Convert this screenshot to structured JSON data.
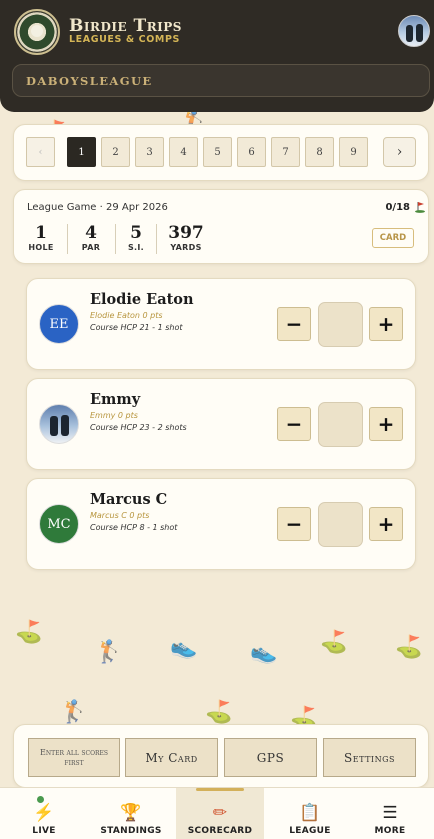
{
  "brand": {
    "title": "Birdie Trips",
    "subtitle": "LEAGUES & COMPS"
  },
  "league": {
    "name": "DABOYSLEAGUE"
  },
  "pager": {
    "prev": "‹",
    "pages": [
      "1",
      "2",
      "3",
      "4",
      "5",
      "6",
      "7",
      "8",
      "9"
    ],
    "active": "1",
    "next": "›"
  },
  "hole": {
    "game_label": "League Game · 29 Apr 2026",
    "progress": "0/18",
    "stats": [
      {
        "value": "1",
        "label": "HOLE"
      },
      {
        "value": "4",
        "label": "PAR"
      },
      {
        "value": "5",
        "label": "S.I."
      },
      {
        "value": "397",
        "label": "YARDS"
      }
    ],
    "card_button": "CARD"
  },
  "players": [
    {
      "initials": "EE",
      "name": "Elodie Eaton",
      "points": "Elodie Eaton 0 pts",
      "hcp": "Course HCP 21 - 1 shot",
      "avatar_color": "#2a63c4"
    },
    {
      "initials": "",
      "name": "Emmy",
      "points": "Emmy 0 pts",
      "hcp": "Course HCP 23 - 2 shots",
      "avatar_color": "photo"
    },
    {
      "initials": "MC",
      "name": "Marcus C",
      "points": "Marcus C 0 pts",
      "hcp": "Course HCP 8 - 1 shot",
      "avatar_color": "#2f7a3a"
    }
  ],
  "controls": {
    "minus": "−",
    "plus": "+"
  },
  "actions": {
    "enter_scores": "Enter all scores first",
    "my_card": "My Card",
    "gps": "GPS",
    "settings": "Settings"
  },
  "nav": [
    {
      "label": "LIVE",
      "icon": "lightning-icon",
      "glyph": "⚡"
    },
    {
      "label": "STANDINGS",
      "icon": "trophy-icon",
      "glyph": "🏆"
    },
    {
      "label": "SCORECARD",
      "icon": "pencil-icon",
      "glyph": "✏"
    },
    {
      "label": "LEAGUE",
      "icon": "clipboard-icon",
      "glyph": "📋"
    },
    {
      "label": "MORE",
      "icon": "menu-icon",
      "glyph": "☰"
    }
  ],
  "colors": {
    "header": "#2f2b25",
    "accent": "#d4b556",
    "background": "#f3ead6"
  }
}
